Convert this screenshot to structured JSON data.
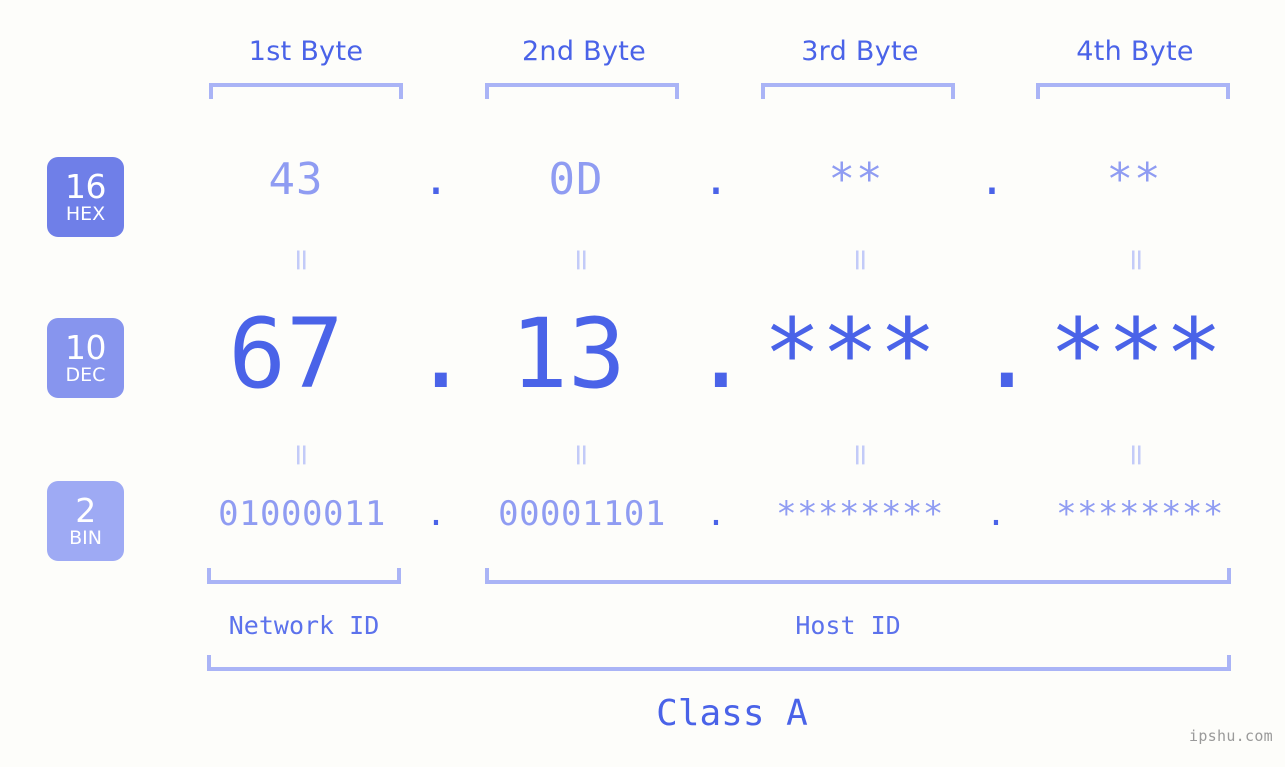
{
  "background_color": "#fdfdfa",
  "accent_color": "#4a63e8",
  "muted_color": "#8f9cf2",
  "bracket_color": "#aab4f6",
  "headers": [
    {
      "label": "1st Byte"
    },
    {
      "label": "2nd Byte"
    },
    {
      "label": "3rd Byte"
    },
    {
      "label": "4th Byte"
    }
  ],
  "bases": [
    {
      "radix": "16",
      "name": "HEX",
      "color": "#6f7fe8"
    },
    {
      "radix": "10",
      "name": "DEC",
      "color": "#8795ee"
    },
    {
      "radix": "2",
      "name": "BIN",
      "color": "#9eaaf4"
    }
  ],
  "rows": {
    "hex": {
      "values": [
        "43",
        "0D",
        "**",
        "**"
      ],
      "separators": [
        ".",
        ".",
        "."
      ]
    },
    "dec": {
      "values": [
        "67",
        "13",
        "***",
        "***"
      ],
      "separators": [
        ".",
        ".",
        "."
      ]
    },
    "bin": {
      "values": [
        "01000011",
        "00001101",
        "********",
        "********"
      ],
      "separators": [
        ".",
        ".",
        "."
      ]
    }
  },
  "separator_marks": {
    "equals": "="
  },
  "id_labels": {
    "network": "Network ID",
    "host": "Host ID"
  },
  "class_label": "Class A",
  "watermark": "ipshu.com"
}
